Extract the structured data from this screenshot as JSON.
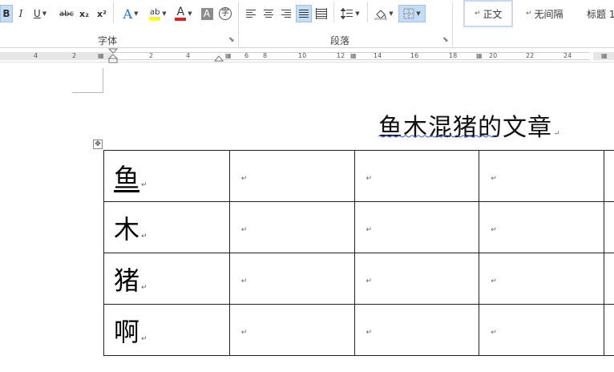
{
  "ribbon": {
    "font_buttons": {
      "bold": "B",
      "italic": "I",
      "underline": "U",
      "strike": "abc",
      "subscript": "x₂",
      "superscript": "x²",
      "text_effect": "A",
      "highlight": "ab",
      "font_color": "A",
      "char_shading": "A",
      "enclose": "字"
    },
    "group_font_label": "字体",
    "group_paragraph_label": "段落",
    "styles": [
      {
        "label": "正文",
        "mark": "↵"
      },
      {
        "label": "无间隔",
        "mark": "↵"
      },
      {
        "label": "标题 1",
        "mark": ""
      }
    ],
    "colors": {
      "highlight": "#ffff00",
      "font_color": "#e02020",
      "active_bg": "#c5dcf5"
    }
  },
  "ruler": {
    "left_labels": [
      "4",
      "2"
    ],
    "right_labels": [
      "2",
      "4",
      "6",
      "8",
      "10",
      "12",
      "14",
      "16",
      "18",
      "20",
      "22",
      "24"
    ]
  },
  "document": {
    "title": "鱼木混猪的文章",
    "para_mark": "↵",
    "table": {
      "rows": [
        [
          "鱼",
          "",
          "",
          "",
          ""
        ],
        [
          "木",
          "",
          "",
          "",
          ""
        ],
        [
          "猪",
          "",
          "",
          "",
          ""
        ],
        [
          "啊",
          "",
          "",
          "",
          ""
        ]
      ]
    }
  }
}
